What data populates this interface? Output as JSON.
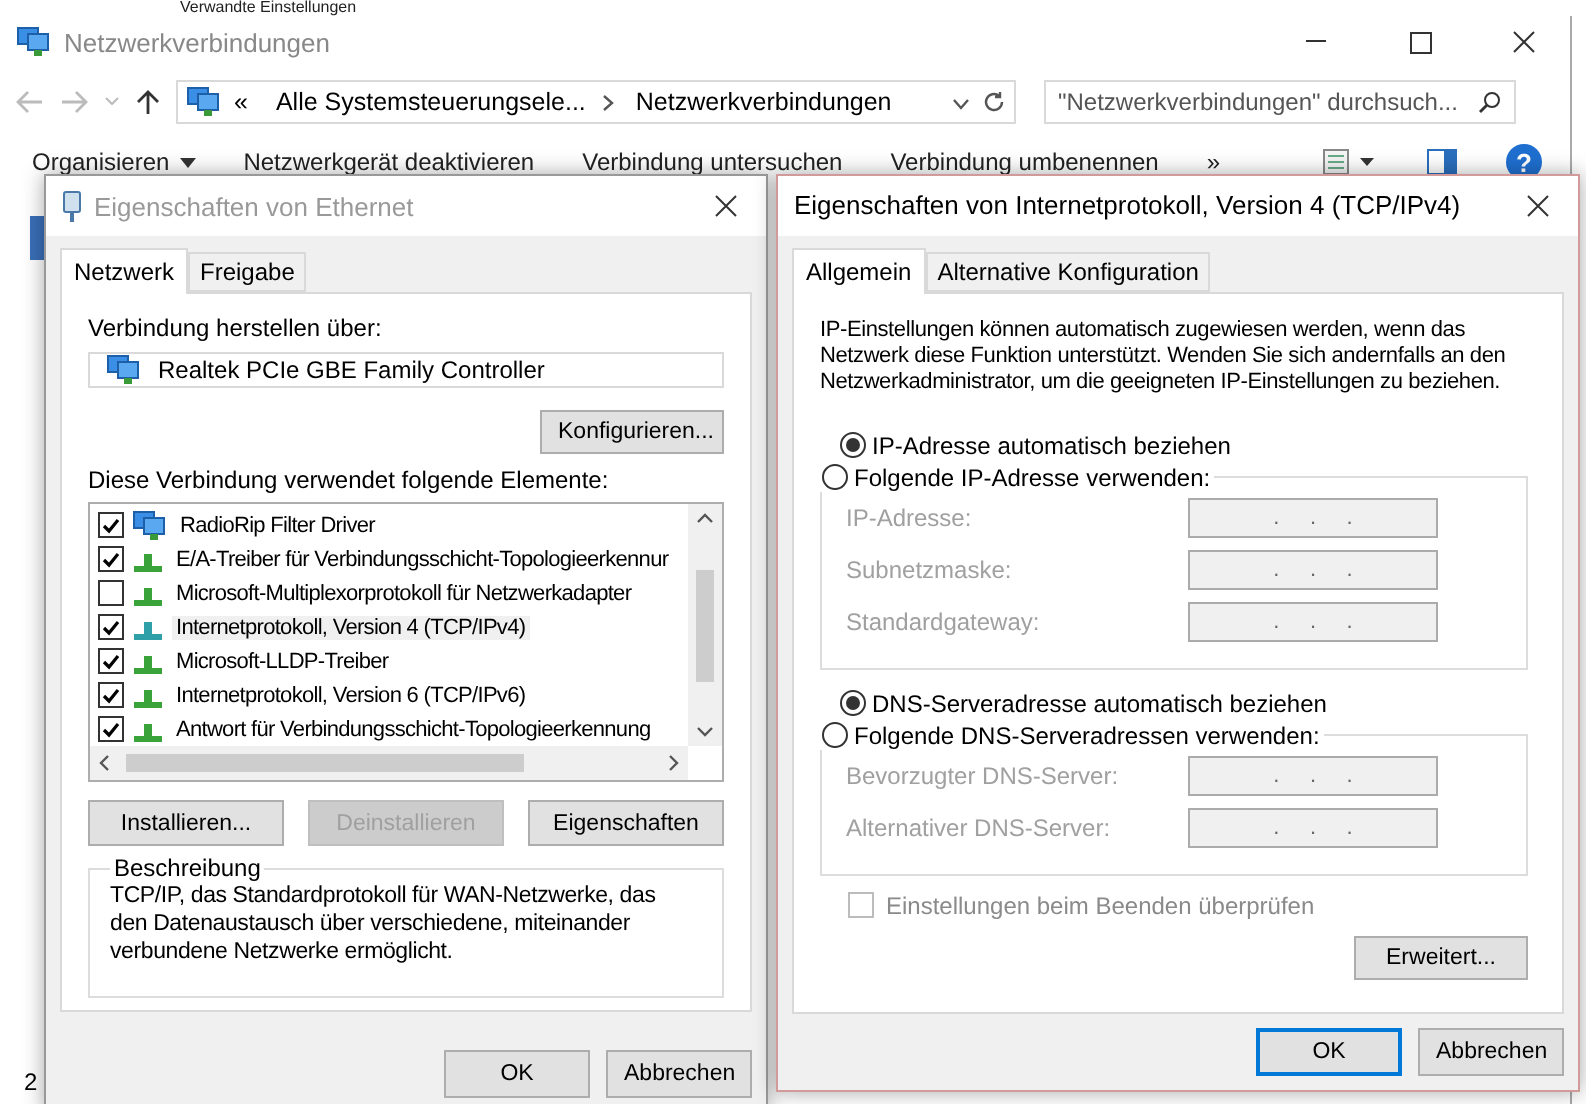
{
  "background_heading": "Verwandte Einstellungen",
  "explorer": {
    "title": "Netzwerkverbindungen",
    "address": {
      "overflow": "«",
      "crumbs": [
        "Alle Systemsteuerungsele...",
        "Netzwerkverbindungen"
      ]
    },
    "search": {
      "placeholder": "\"Netzwerkverbindungen\" durchsuch..."
    },
    "toolbar": [
      {
        "label": "Organisieren",
        "kind": "menu"
      },
      {
        "label": "Netzwerkgerät deaktivieren",
        "kind": "command"
      },
      {
        "label": "Verbindung untersuchen",
        "kind": "command"
      },
      {
        "label": "Verbindung umbenennen",
        "kind": "command"
      },
      {
        "label": "»",
        "kind": "command"
      }
    ],
    "help_glyph": "?",
    "status": "2"
  },
  "ethernet_dialog": {
    "title": "Eigenschaften von Ethernet",
    "active": false,
    "tabs": [
      {
        "label": "Netzwerk",
        "selected": true
      },
      {
        "label": "Freigabe",
        "selected": false
      }
    ],
    "connect_label": "Verbindung herstellen über:",
    "adapter": "Realtek PCIe GBE Family Controller",
    "configure_button": "Konfigurieren...",
    "elements_label": "Diese Verbindung verwendet folgende Elemente:",
    "items": [
      {
        "label": "RadioRip Filter Driver",
        "checked": true,
        "selected": false,
        "kind": "adapter"
      },
      {
        "label": "E/A-Treiber für Verbindungsschicht-Topologieerkennur",
        "checked": true,
        "selected": false,
        "kind": "protocol"
      },
      {
        "label": "Microsoft-Multiplexorprotokoll für Netzwerkadapter",
        "checked": false,
        "selected": false,
        "kind": "protocol"
      },
      {
        "label": "Internetprotokoll, Version 4 (TCP/IPv4)",
        "checked": true,
        "selected": true,
        "kind": "protocol"
      },
      {
        "label": "Microsoft-LLDP-Treiber",
        "checked": true,
        "selected": false,
        "kind": "protocol"
      },
      {
        "label": "Internetprotokoll, Version 6 (TCP/IPv6)",
        "checked": true,
        "selected": false,
        "kind": "protocol"
      },
      {
        "label": "Antwort für Verbindungsschicht-Topologieerkennung",
        "checked": true,
        "selected": false,
        "kind": "protocol"
      }
    ],
    "item_buttons": [
      {
        "label": "Installieren...",
        "disabled": false
      },
      {
        "label": "Deinstallieren",
        "disabled": true
      },
      {
        "label": "Eigenschaften",
        "disabled": false
      }
    ],
    "description_title": "Beschreibung",
    "description": "TCP/IP, das Standardprotokoll für WAN-Netzwerke, das den Datenaustausch über verschiedene, miteinander verbundene Netzwerke ermöglicht.",
    "footer_buttons": [
      {
        "label": "OK",
        "default": false
      },
      {
        "label": "Abbrechen",
        "default": false
      }
    ]
  },
  "ipv4_dialog": {
    "title": "Eigenschaften von Internetprotokoll, Version 4 (TCP/IPv4)",
    "active": true,
    "tabs": [
      {
        "label": "Allgemein",
        "selected": true
      },
      {
        "label": "Alternative Konfiguration",
        "selected": false
      }
    ],
    "intro": "IP-Einstellungen können automatisch zugewiesen werden, wenn das Netzwerk diese Funktion unterstützt. Wenden Sie sich andernfalls an den Netzwerkadministrator, um die geeigneten IP-Einstellungen zu beziehen.",
    "sections": [
      {
        "auto": {
          "label": "IP-Adresse automatisch beziehen",
          "selected": true
        },
        "manual": {
          "label": "Folgende IP-Adresse verwenden:",
          "selected": false
        },
        "fields": [
          {
            "label": "IP-Adresse:",
            "value": ".     .     .",
            "disabled": true
          },
          {
            "label": "Subnetzmaske:",
            "value": ".     .     .",
            "disabled": true
          },
          {
            "label": "Standardgateway:",
            "value": ".     .     .",
            "disabled": true
          }
        ]
      },
      {
        "auto": {
          "label": "DNS-Serveradresse automatisch beziehen",
          "selected": true
        },
        "manual": {
          "label": "Folgende DNS-Serveradressen verwenden:",
          "selected": false
        },
        "fields": [
          {
            "label": "Bevorzugter DNS-Server:",
            "value": ".     .     .",
            "disabled": true
          },
          {
            "label": "Alternativer DNS-Server:",
            "value": ".     .     .",
            "disabled": true
          }
        ]
      }
    ],
    "validate": {
      "label": "Einstellungen beim Beenden überprüfen",
      "checked": false,
      "disabled": true
    },
    "advanced_button": "Erweitert...",
    "footer_buttons": [
      {
        "label": "OK",
        "default": true
      },
      {
        "label": "Abbrechen",
        "default": false
      }
    ]
  }
}
